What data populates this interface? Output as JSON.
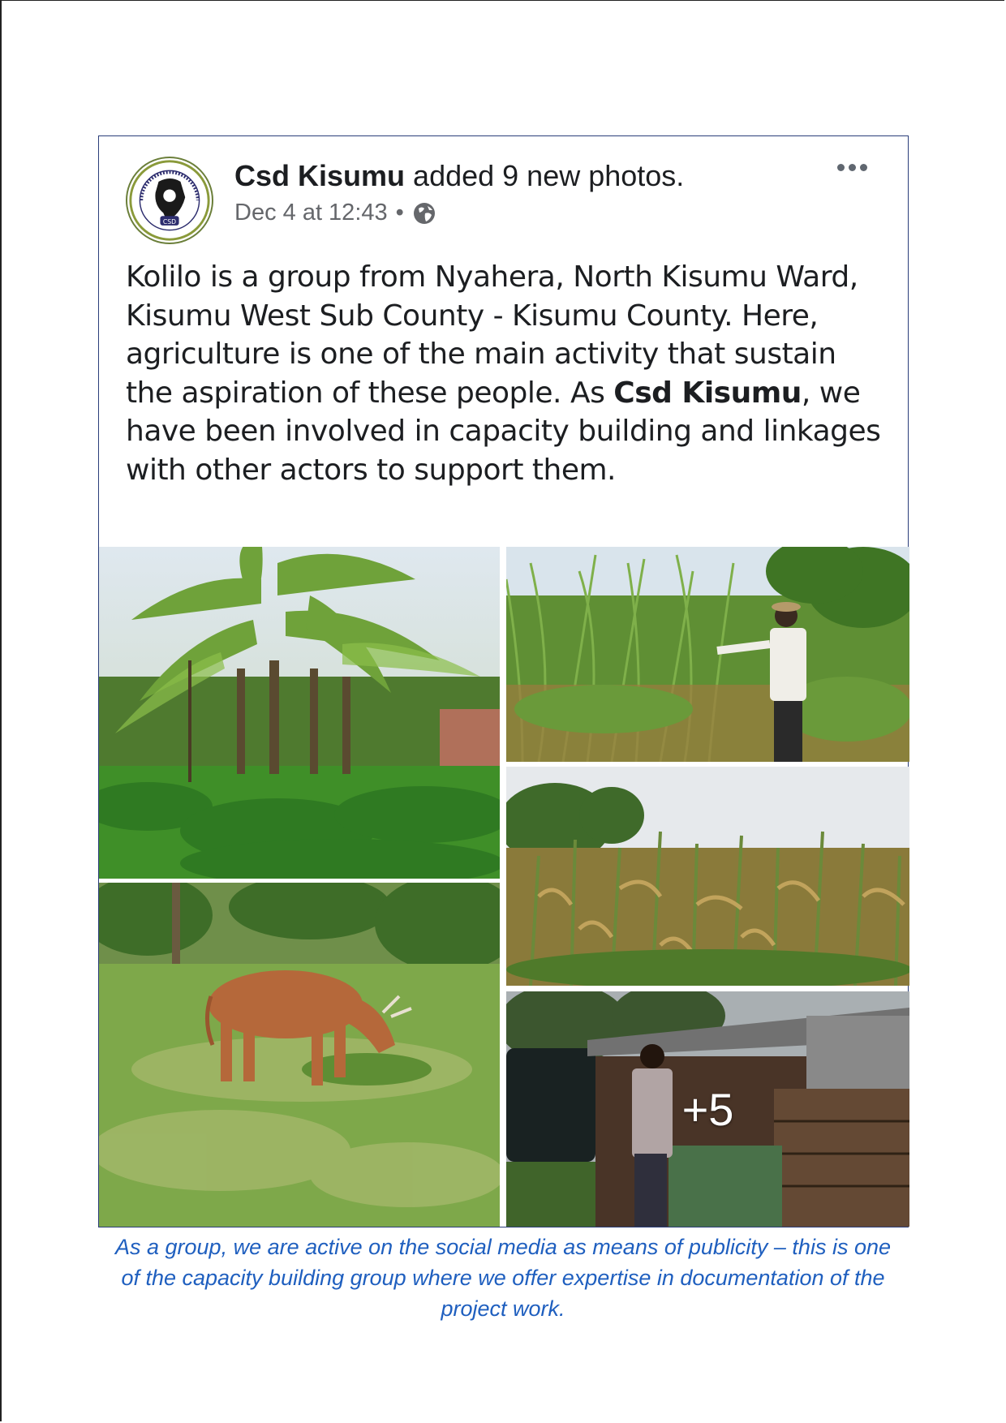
{
  "post": {
    "author": "Csd Kisumu",
    "action": "added 9 new photos.",
    "timestamp": "Dec 4 at 12:43",
    "separator": "•",
    "audience_icon": "globe-icon",
    "more_icon": "ellipsis-icon",
    "text_part1": "Kolilo is a group from Nyahera, North Kisumu Ward, Kisumu West Sub County - Kisumu County. Here, agriculture is one of the main activity that sustain the aspiration of these people. As ",
    "text_bold": "Csd Kisumu",
    "text_part2": ", we have been involved in capacity building and linkages with other actors to support them.",
    "photos": [
      {
        "subject": "banana plants with sweet potato ground cover"
      },
      {
        "subject": "man standing in tall napier grass"
      },
      {
        "subject": "maize field"
      },
      {
        "subject": "brown cow grazing"
      },
      {
        "subject": "man at livestock shed with water tank"
      }
    ],
    "more_photos_label": "+5"
  },
  "caption": "As a group, we are active on the social media as means of publicity – this is one of the capacity building group where we offer expertise in documentation of the project work.",
  "colors": {
    "border": "#2b3e7a",
    "caption": "#1f5fbf",
    "meta": "#65676b",
    "text": "#1c1e21"
  }
}
